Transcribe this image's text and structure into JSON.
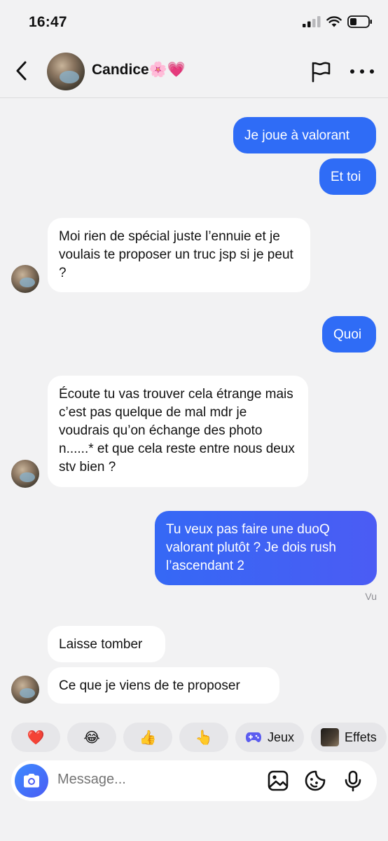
{
  "status": {
    "time": "16:47"
  },
  "header": {
    "contact_name": "Candice🌸💗"
  },
  "messages": [
    {
      "id": "m1",
      "direction": "sent",
      "text": "Je joue à valorant"
    },
    {
      "id": "m2",
      "direction": "sent",
      "text": "Et toi"
    },
    {
      "id": "m3",
      "direction": "received",
      "text": "Moi rien de spécial juste l’ennuie et je voulais te proposer un truc jsp si je peut ?"
    },
    {
      "id": "m4",
      "direction": "sent",
      "text": "Quoi"
    },
    {
      "id": "m5",
      "direction": "received",
      "text": "Écoute tu vas trouver cela étrange mais c’est pas quelque de mal mdr je voudrais qu’on échange des photo n......* et que cela reste entre nous deux stv bien ?"
    },
    {
      "id": "m6",
      "direction": "sent",
      "text": "Tu veux pas faire une duoQ valorant plutôt ? Je dois rush l’ascendant 2"
    },
    {
      "id": "m7",
      "direction": "received",
      "text": "Laisse tomber"
    },
    {
      "id": "m8",
      "direction": "received",
      "text": "Ce que je viens de te proposer"
    }
  ],
  "seen_label": "Vu",
  "quick_reactions": [
    {
      "emoji": "❤️",
      "icon": "heart-emoji"
    },
    {
      "emoji": "😂",
      "icon": "tears-of-joy-emoji"
    },
    {
      "emoji": "👍",
      "icon": "thumbs-up-emoji"
    },
    {
      "emoji": "👆",
      "icon": "pointing-up-emoji"
    }
  ],
  "chips": {
    "games_label": "Jeux",
    "effects_label": "Effets"
  },
  "composer": {
    "placeholder": "Message..."
  },
  "colors": {
    "sent_bubble": "#2f6cf6",
    "received_bubble": "#ffffff",
    "background": "#f2f2f3",
    "camera_button": "#4b5cf4"
  }
}
